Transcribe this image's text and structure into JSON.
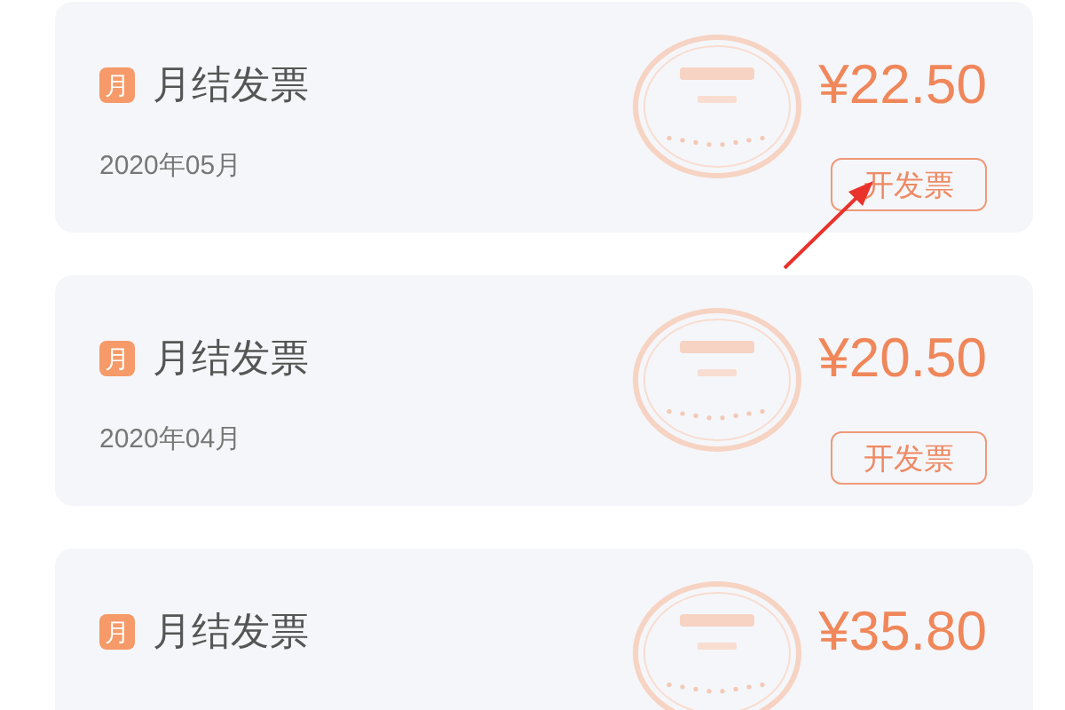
{
  "invoices": [
    {
      "badge": "月",
      "title": "月结发票",
      "date": "2020年05月",
      "amount": "¥22.50",
      "button": "开发票",
      "annotated": true
    },
    {
      "badge": "月",
      "title": "月结发票",
      "date": "2020年04月",
      "amount": "¥20.50",
      "button": "开发票"
    },
    {
      "badge": "月",
      "title": "月结发票",
      "amount": "¥35.80"
    }
  ]
}
